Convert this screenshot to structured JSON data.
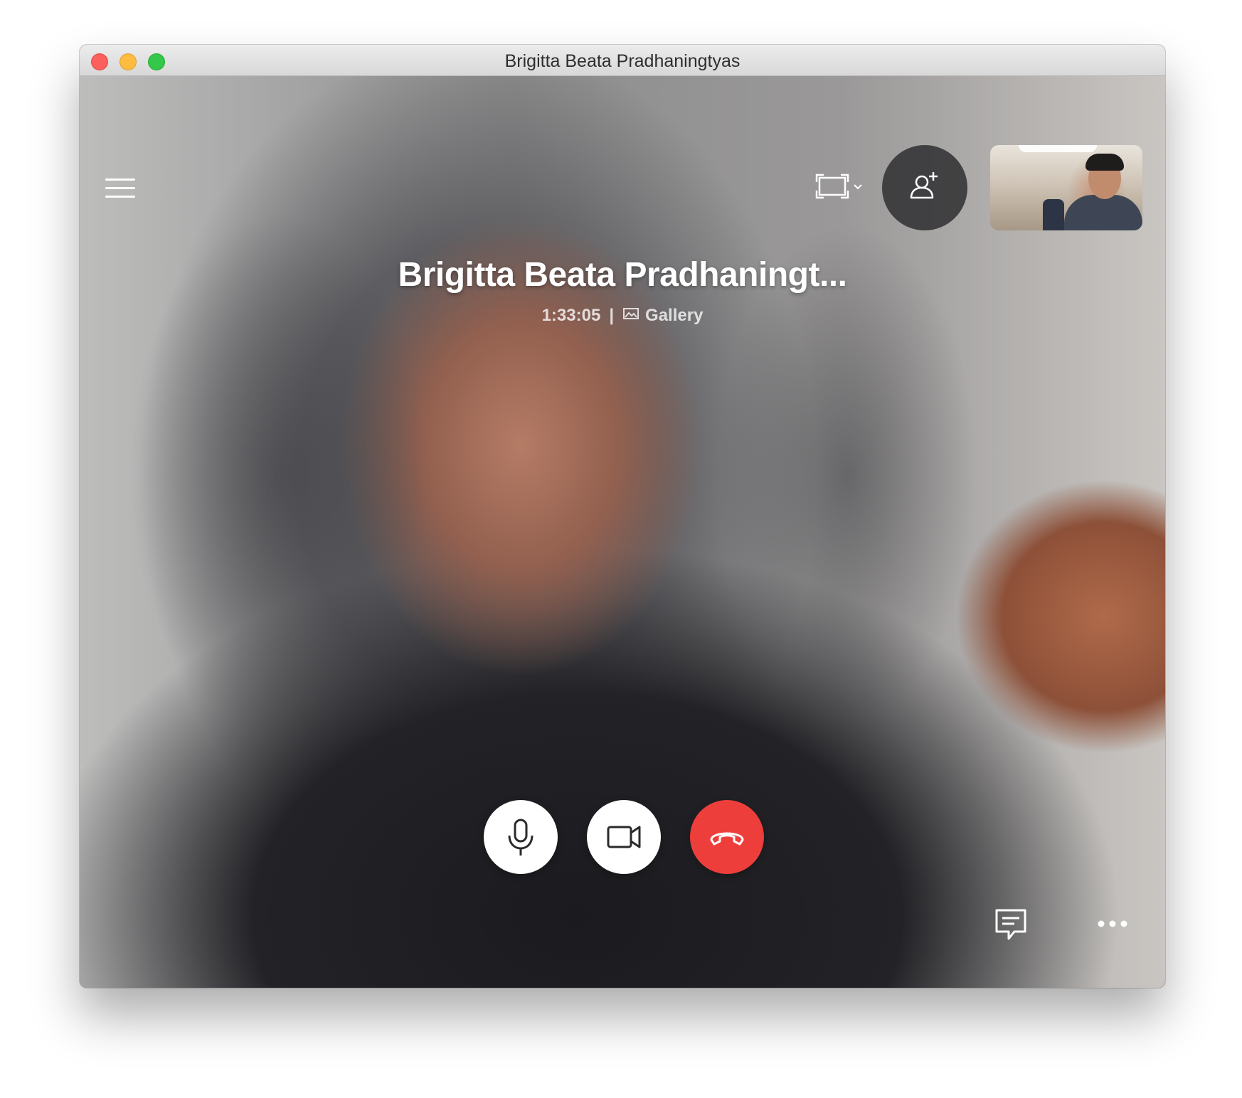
{
  "window": {
    "title": "Brigitta Beata Pradhaningtyas"
  },
  "call": {
    "caller_name": "Brigitta Beata Pradhaningt...",
    "duration": "1:33:05",
    "separator": "|",
    "gallery_label": "Gallery"
  },
  "icons": {
    "menu": "hamburger-menu-icon",
    "view": "fullscreen-view-icon",
    "add_person": "add-person-icon",
    "mic": "microphone-icon",
    "camera": "video-camera-icon",
    "hangup": "hang-up-phone-icon",
    "chat": "chat-icon",
    "more": "more-options-icon",
    "gallery": "gallery-image-icon"
  },
  "colors": {
    "end_call": "#ee3e3c",
    "control_bg": "#ffffff",
    "add_person_bg": "#323234"
  }
}
